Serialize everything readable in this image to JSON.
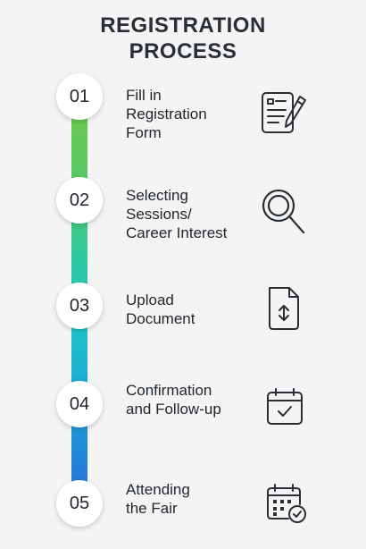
{
  "title": {
    "line1": "REGISTRATION",
    "line2": "PROCESS"
  },
  "steps": [
    {
      "number": "01",
      "lines": [
        "Fill in",
        "Registration",
        "Form"
      ],
      "icon": "form-pen-icon"
    },
    {
      "number": "02",
      "lines": [
        "Selecting",
        "Sessions/",
        "Career Interest"
      ],
      "icon": "magnifier-icon"
    },
    {
      "number": "03",
      "lines": [
        "Upload",
        "Document"
      ],
      "icon": "upload-document-icon"
    },
    {
      "number": "04",
      "lines": [
        "Confirmation",
        "and Follow-up"
      ],
      "icon": "calendar-check-icon"
    },
    {
      "number": "05",
      "lines": [
        "Attending",
        "the Fair"
      ],
      "icon": "calendar-grid-check-icon"
    }
  ]
}
